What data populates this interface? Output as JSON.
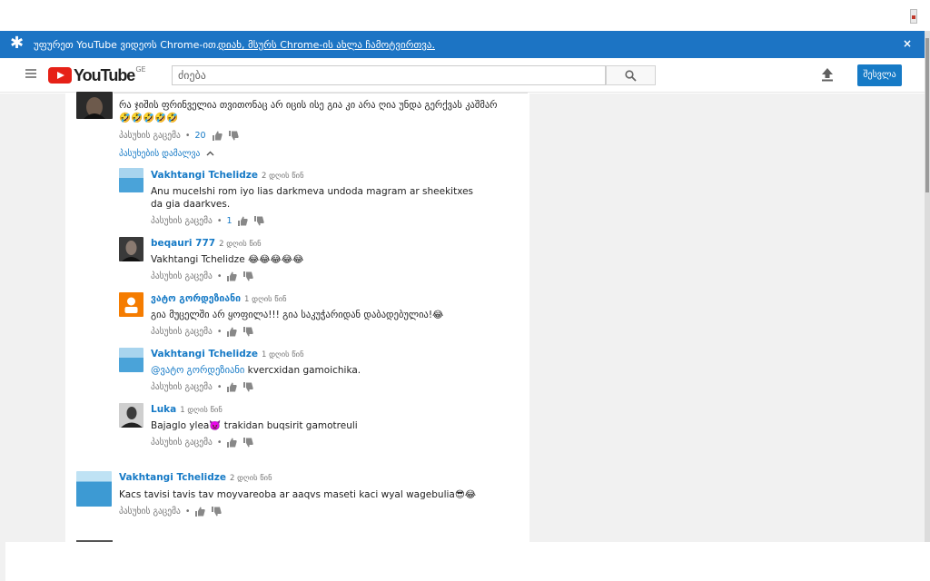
{
  "banner": {
    "message": "უფურეთ YouTube ვიდეოს Chrome-ით.",
    "link": "დიახ, მსურს Chrome-ის ახლა ჩამოტვირთვა.",
    "close": "×"
  },
  "header": {
    "logo_text": "YouTube",
    "logo_country": "GE",
    "search_placeholder": "ძიება",
    "signin_label": "შესვლა"
  },
  "comments": [
    {
      "text": "რა ჯიშის ფრინველია თვითონაც არ იცის ისე გია კი არა ღია უნდა გერქვას კაშმარ 🤣🤣🤣🤣🤣",
      "reply_label": "პასუხის გაცემა",
      "likes": "20",
      "hide_replies": "პასუხების დამალვა"
    }
  ],
  "replies": [
    {
      "author": "Vakhtangi Tchelidze",
      "time": "2 დღის წინ",
      "text": "Anu mucelshi rom iyo lias darkmeva undoda magram ar sheekitxes da gia daarkves.",
      "reply_label": "პასუხის გაცემა",
      "likes": "1"
    },
    {
      "author": "beqauri 777",
      "time": "2 დღის წინ",
      "text": "Vakhtangi Tchelidze 😂😂😂😂😂",
      "reply_label": "პასუხის გაცემა",
      "likes": ""
    },
    {
      "author": "ვატო გორდეზიანი",
      "time": "1 დღის წინ",
      "text": "გია მუცელში არ ყოფილა!!! გია საკუჭარიდან დაბადებულია!😂",
      "reply_label": "პასუხის გაცემა",
      "likes": ""
    },
    {
      "author": "Vakhtangi Tchelidze",
      "time": "1 დღის წინ",
      "mention": "@ვატო გორდეზიანი",
      "text": "kvercxidan gamoichika.",
      "reply_label": "პასუხის გაცემა",
      "likes": ""
    },
    {
      "author": "Luka",
      "time": "1 დღის წინ",
      "text": "Bajaglo ylea👿 trakidan buqsirit gamotreuli",
      "reply_label": "პასუხის გაცემა",
      "likes": ""
    }
  ],
  "comment2": {
    "author": "Vakhtangi Tchelidze",
    "time": "2 დღის წინ",
    "text": "Kacs tavisi tavis tav moyvareoba ar aaqvs maseti kaci wyal wagebulia😎😂",
    "reply_label": "პასუხის გაცემა"
  },
  "colors": {
    "banner": "#1c74c4",
    "link": "#167ac6",
    "logo_red": "#e62117",
    "gutter": "#f1f1f1"
  },
  "icons": [
    "star-icon",
    "close-icon",
    "menu-icon",
    "youtube-logo",
    "search-icon",
    "upload-icon",
    "thumb-up-icon",
    "thumb-down-icon",
    "chevron-up-icon"
  ]
}
